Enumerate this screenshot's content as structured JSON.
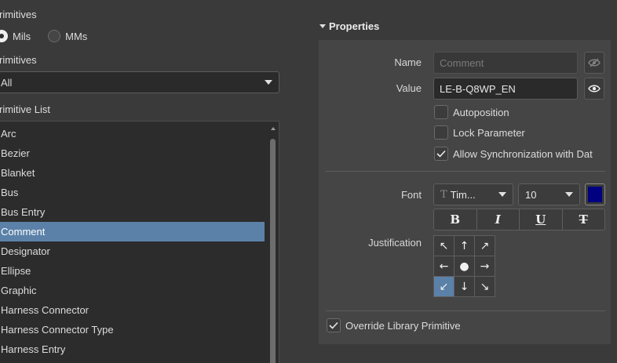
{
  "left": {
    "primitives_units_label": "rimitives",
    "units": [
      {
        "label": "Mils",
        "checked": true
      },
      {
        "label": "MMs",
        "checked": false
      }
    ],
    "primitives_filter_label": "rimitives",
    "filter_value": "All",
    "list_label": "rimitive List",
    "list_items": [
      "Arc",
      "Bezier",
      "Blanket",
      "Bus",
      "Bus Entry",
      "Comment",
      "Designator",
      "Ellipse",
      "Graphic",
      "Harness Connector",
      "Harness Connector Type",
      "Harness Entry"
    ],
    "selected_item": "Comment"
  },
  "properties": {
    "header": "Properties",
    "name_label": "Name",
    "name_placeholder": "Comment",
    "value_label": "Value",
    "value": "LE-B-Q8WP_EN",
    "autoposition_label": "Autoposition",
    "lock_parameter_label": "Lock Parameter",
    "allow_sync_label": "Allow Synchronization with Dat",
    "autoposition_checked": false,
    "lock_parameter_checked": false,
    "allow_sync_checked": true,
    "font_label": "Font",
    "font_name": "Tim...",
    "font_size": "10",
    "font_color": "#000080",
    "style_buttons": [
      "B",
      "I",
      "U",
      "T"
    ],
    "justification_label": "Justification",
    "justification_arrows": [
      "↖",
      "↑",
      "↗",
      "←",
      "●",
      "→",
      "↙",
      "↓",
      "↘"
    ],
    "justification_selected": 6,
    "override_label": "Override Library Primitive",
    "override_checked": true
  }
}
